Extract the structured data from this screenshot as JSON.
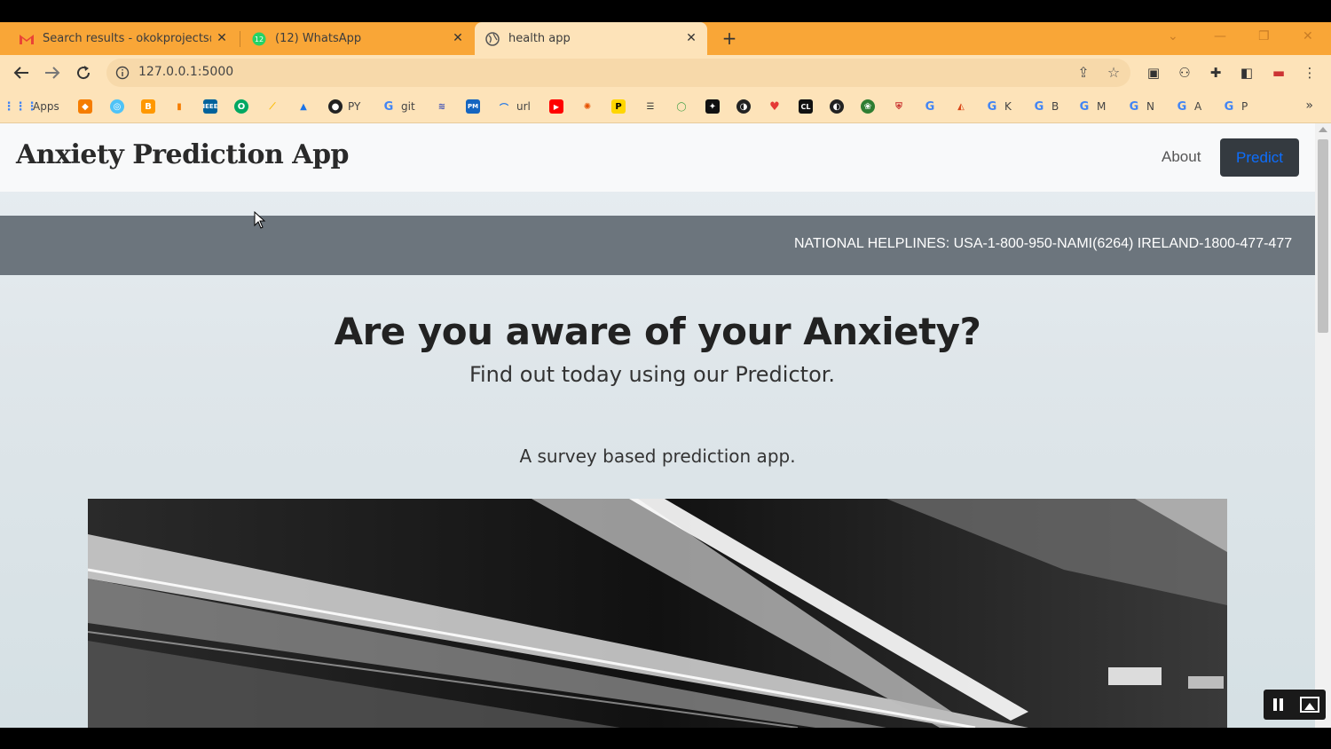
{
  "browser": {
    "tabs": [
      {
        "title": "Search results - okokprojects@g",
        "icon": "gmail-icon"
      },
      {
        "title": "(12) WhatsApp",
        "icon": "whatsapp-icon",
        "badge": "12"
      },
      {
        "title": "health app",
        "icon": "globe-icon"
      }
    ],
    "url": "127.0.0.1:5000",
    "bookmarks": [
      {
        "label": "Apps",
        "icon": "apps-grid-icon"
      },
      {
        "label": "PY",
        "icon": "github-icon"
      },
      {
        "label": "git",
        "icon": "google-icon"
      },
      {
        "label": "url",
        "icon": "arc-icon"
      },
      {
        "label": "K",
        "icon": "google-icon"
      },
      {
        "label": "B",
        "icon": "google-icon"
      },
      {
        "label": "M",
        "icon": "google-icon"
      },
      {
        "label": "N",
        "icon": "google-icon"
      },
      {
        "label": "A",
        "icon": "google-icon"
      },
      {
        "label": "P",
        "icon": "google-icon"
      }
    ],
    "colors": {
      "tab_strip": "#f9a637",
      "toolbar": "#fde3b9"
    }
  },
  "page": {
    "brand": "Anxiety Prediction App",
    "nav": {
      "about": "About",
      "predict": "Predict"
    },
    "marquee": "NATIONAL HELPLINES: USA-1-800-950-NAMI(6264) IRELAND-1800-477-477",
    "hero": {
      "title_prefix": "Are you aware of your ",
      "title_emphasis": "Anxiety?",
      "subtitle": "Find out today using our Predictor.",
      "description": "A survey based prediction app."
    },
    "colors": {
      "navbar_bg": "#f8f9fa",
      "marquee_bg": "#6c757d",
      "predict_bg": "#343a40",
      "predict_text": "#0d6efd"
    }
  }
}
